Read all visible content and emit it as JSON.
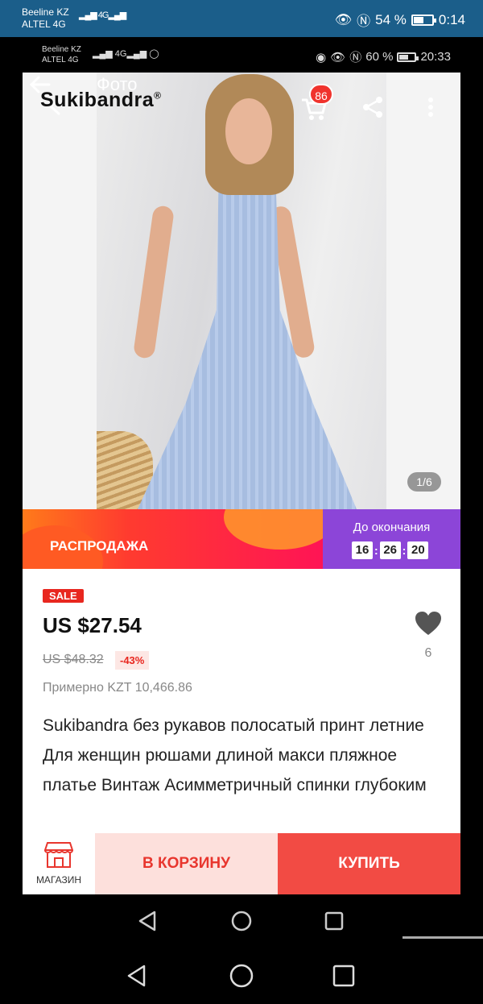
{
  "outer_status": {
    "carrier_1": "Beeline KZ",
    "carrier_2": "ALTEL 4G",
    "signal": "4G",
    "battery_percent": "54 %",
    "battery_level": 0.54,
    "time": "0:14"
  },
  "inner_status": {
    "carrier_1": "Beeline KZ",
    "carrier_2": "ALTEL 4G",
    "signal": "4G",
    "battery_percent": "60 %",
    "battery_level": 0.6,
    "time": "20:33"
  },
  "photo": {
    "title": "Фото",
    "brand": "Sukibandra",
    "brand_mark": "®",
    "cart_count": "86",
    "counter": "1/6"
  },
  "banner": {
    "title": "РАСПРОДАЖА",
    "countdown_caption": "До окончания",
    "timer": [
      "16",
      "26",
      "20"
    ]
  },
  "product": {
    "sale_tag": "SALE",
    "price": "US $27.54",
    "old_price": "US $48.32",
    "discount": "-43%",
    "approx_price": "Примерно KZT 10,466.86",
    "wishlist_count": "6",
    "title": "Sukibandra без рукавов полосатый принт летние Для женщин рюшами длиной макси пляжное платье Винтаж Асимметричный спинки глубоким"
  },
  "actions": {
    "store_label": "МАГАЗИН",
    "cart_label": "В КОРЗИНУ",
    "buy_label": "КУПИТЬ"
  },
  "icons": {
    "back": "arrow-left-icon",
    "cart": "shopping-cart-icon",
    "share": "share-icon",
    "more": "more-vertical-icon",
    "heart": "heart-icon",
    "store": "store-icon",
    "nav_back": "triangle-back-icon",
    "nav_home": "circle-home-icon",
    "nav_recent": "square-recents-icon"
  },
  "colors": {
    "accent": "#f24b44",
    "sale_purple": "#8c45d8",
    "status_blue": "#1b5e8a"
  }
}
